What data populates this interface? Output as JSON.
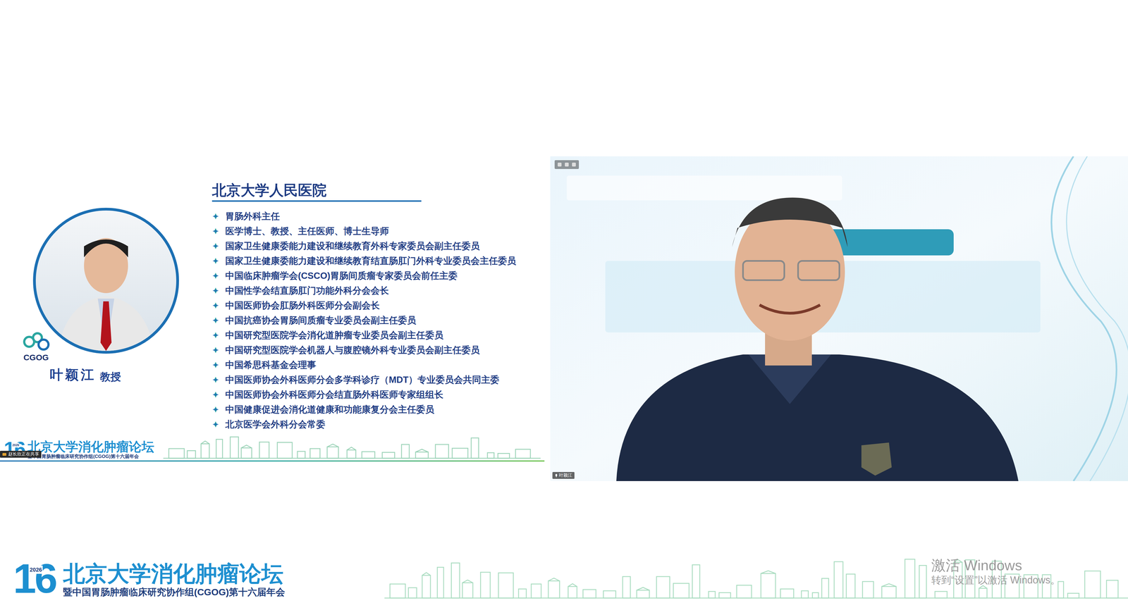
{
  "slide": {
    "hospital": "北京大学人民医院",
    "bio": [
      "胃肠外科主任",
      "医学博士、教授、主任医师、博士生导师",
      "国家卫生健康委能力建设和继续教育外科专家委员会副主任委员",
      "国家卫生健康委能力建设和继续教育结直肠肛门外科专业委员会主任委员",
      "中国临床肿瘤学会(CSCO)胃肠间质瘤专家委员会前任主委",
      "中国性学会结直肠肛门功能外科分会会长",
      "中国医师协会肛肠外科医师分会副会长",
      "中国抗癌协会胃肠间质瘤专业委员会副主任委员",
      "中国研究型医院学会消化道肿瘤专业委员会副主任委员",
      "中国研究型医院学会机器人与腹腔镜外科专业委员会副主任委员",
      "中国希思科基金会理事",
      "中国医师协会外科医师分会多学科诊疗（MDT）专业委员会共同主委",
      "中国医师协会外科医师分会结直肠外科医师专家组组长",
      "中国健康促进会消化道健康和功能康复分会主任委员",
      "北京医学会外科分会常委"
    ],
    "speaker": "叶颖江",
    "speaker_title": "教授",
    "logo_text": "CGOG",
    "footer": {
      "number": "16",
      "year": "2026",
      "title": "北京大学消化肿瘤论坛",
      "subtitle": "暨中国胃肠肿瘤临床研究协作组(CGOG)第十六届年会"
    }
  },
  "share_indicator": "赵长欣正在共享",
  "video": {
    "participant": "叶颖江"
  },
  "banner": {
    "number": "16",
    "year": "2026",
    "title": "北京大学消化肿瘤论坛",
    "subtitle": "暨中国胃肠肿瘤临床研究协作组(CGOG)第十六届年会"
  },
  "watermark": {
    "title": "激活 Windows",
    "subtitle": "转到“设置”以激活 Windows。"
  }
}
